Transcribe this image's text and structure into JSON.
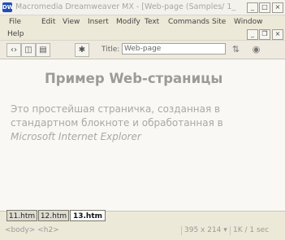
{
  "window": {
    "title": "Macromedia Dreamweaver MX - [Web-page (Samples/ 1_",
    "app_icon": "dreamweaver-icon",
    "controls": {
      "minimize": "_",
      "maximize": "□",
      "close": "×"
    }
  },
  "menu": {
    "items": [
      "File",
      "Edit",
      "View",
      "Insert",
      "Modify",
      "Text",
      "Commands",
      "Site",
      "Window",
      "Help"
    ],
    "doc_controls": {
      "minimize": "_",
      "restore": "❐",
      "close": "×"
    }
  },
  "toolbar": {
    "view_icons": [
      "code-view-icon",
      "split-view-icon",
      "design-view-icon",
      "live-data-icon"
    ],
    "title_label": "Title:",
    "title_value": "Web-page",
    "right_icons": [
      "file-management-icon",
      "preview-icon"
    ]
  },
  "document": {
    "heading": "Пример Web-страницы",
    "paragraph_part1": "Это простейшая страничка, созданная в стандартном блокноте и обработанная в ",
    "paragraph_italic": "Microsoft Internet Explorer"
  },
  "tabs": [
    "11.htm",
    "12.htm",
    "13.htm *"
  ],
  "status": {
    "tag_selector": "<body> <h2>",
    "window_size": "395 x 214 ▾",
    "download_stats": "1K / 1 sec"
  }
}
